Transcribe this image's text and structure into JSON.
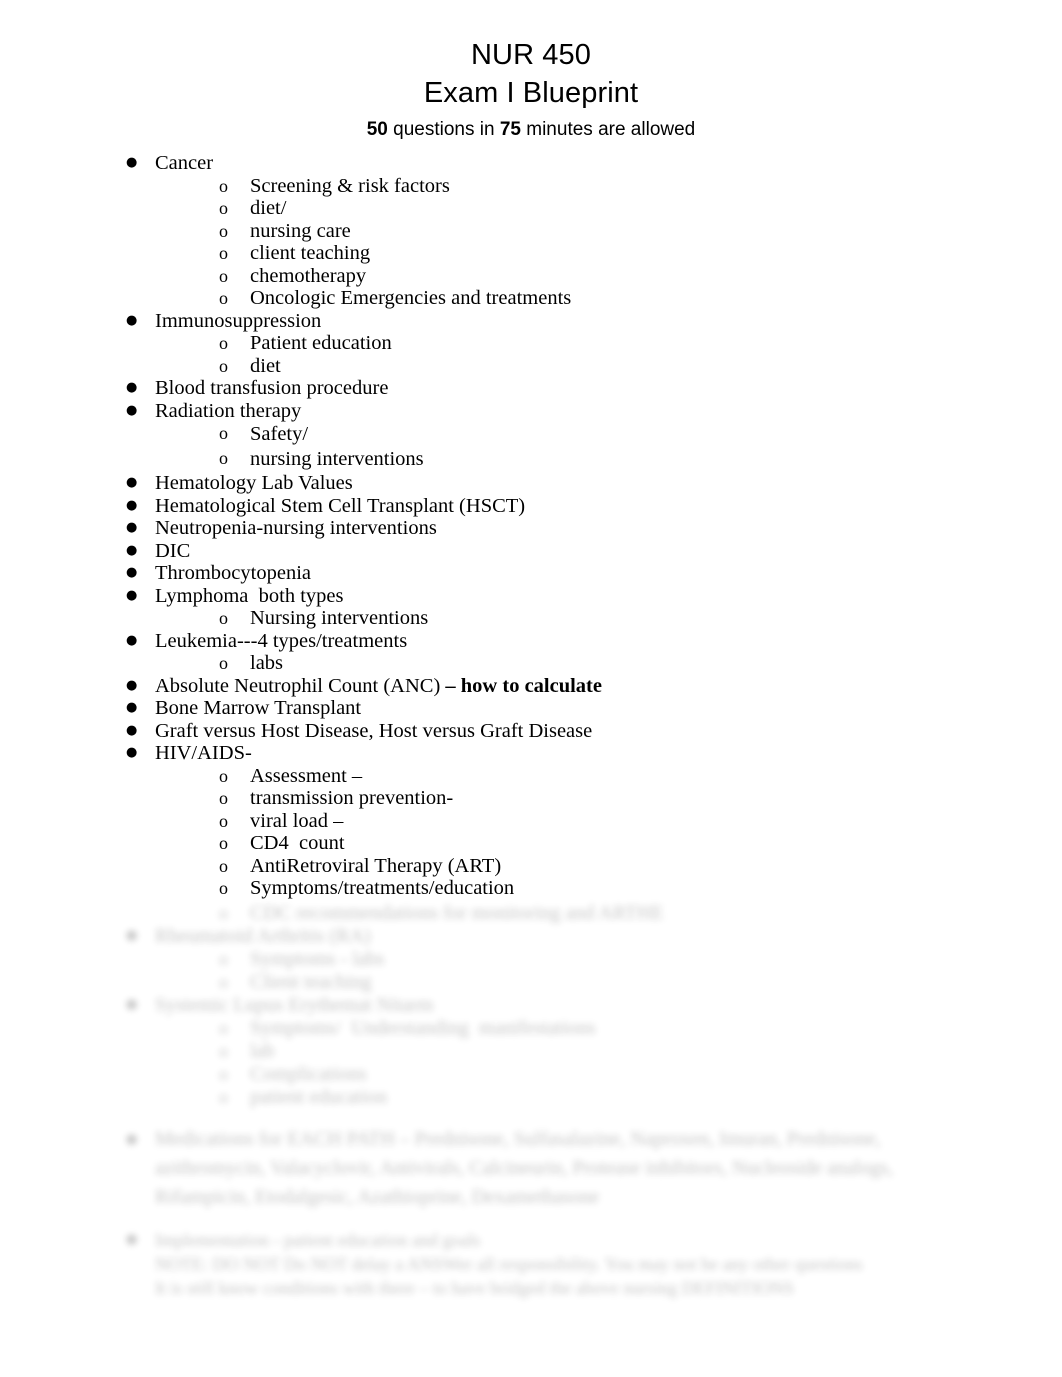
{
  "document": {
    "title_line_1": "NUR 450",
    "title_line_2": "Exam I Blueprint",
    "subtitle": {
      "question_count": "50",
      "mid_text": " questions in ",
      "minute_count": "75",
      "tail_text": " minutes are allowed"
    }
  },
  "outline": [
    {
      "label": "Cancer",
      "children": [
        {
          "label": "Screening & risk factors"
        },
        {
          "label": "diet/"
        },
        {
          "label": "nursing care"
        },
        {
          "label": "client teaching"
        },
        {
          "label": "chemotherapy"
        },
        {
          "label": "Oncologic Emergencies and treatments"
        }
      ]
    },
    {
      "label": "Immunosuppression",
      "children": [
        {
          "label": "Patient education"
        },
        {
          "label": "diet"
        }
      ]
    },
    {
      "label": "Blood transfusion procedure",
      "children": []
    },
    {
      "label": "Radiation therapy",
      "children": [
        {
          "label": "Safety/"
        },
        {
          "label": "nursing interventions"
        }
      ]
    },
    {
      "label": "Hematology Lab Values",
      "children": []
    },
    {
      "label": "Hematological Stem Cell Transplant (HSCT)",
      "children": []
    },
    {
      "label": "Neutropenia-nursing interventions",
      "children": []
    },
    {
      "label": "DIC",
      "children": []
    },
    {
      "label": "Thrombocytopenia",
      "children": []
    },
    {
      "label": "Lymphoma  both types",
      "children": [
        {
          "label": "Nursing interventions"
        }
      ]
    },
    {
      "label": "Leukemia---4 types/treatments",
      "children": [
        {
          "label": "labs"
        }
      ]
    },
    {
      "label_plain": "Absolute Neutrophil Count (ANC) ",
      "label_bold": "– how to calculate",
      "children": []
    },
    {
      "label": "Bone Marrow Transplant",
      "children": []
    },
    {
      "label": "Graft versus Host Disease, Host versus Graft Disease",
      "children": []
    },
    {
      "label": "HIV/AIDS-",
      "children": [
        {
          "label": "Assessment –"
        },
        {
          "label": "transmission prevention-"
        },
        {
          "label": "viral load –"
        },
        {
          "label": "CD4  count"
        },
        {
          "label": "AntiRetroviral Therapy (ART)"
        },
        {
          "label": "Symptoms/treatments/education"
        }
      ]
    }
  ],
  "redacted": {
    "note": "Remaining content is obscured by blur in the source image and is not legible.",
    "placeholder_lines": [
      {
        "level": 2,
        "text": "CDC recommendations for monitoring and ARTHE"
      },
      {
        "level": 1,
        "text": "Rheumatoid Arthritis (RA)"
      },
      {
        "level": 2,
        "text": "Symptoms - labs"
      },
      {
        "level": 2,
        "text": "Client teaching"
      },
      {
        "level": 1,
        "text": "Systemic Lupus Erythemat Nitarm"
      },
      {
        "level": 2,
        "text": "Symptoms/  Understanding  manifestations"
      },
      {
        "level": 2,
        "text": "lab"
      },
      {
        "level": 2,
        "text": "Complications"
      },
      {
        "level": 2,
        "text": "patient education"
      }
    ],
    "paragraph": {
      "text": "Medications for EACH PATH –   Prednisone, Sulfasalazine, Naproxen, Imuran, Prednisone, azithromycin, Valacyclovir, Antivirals, Calcineurin, Protease inhibitors, Nucleoside analogs, Rifampicin, Etodalgesic, Azathioprine, Dexamethasone"
    },
    "closing": {
      "line1": "Implementation - patient education and goals",
      "line2": "NOTE: DO NOT     Do NOT  delay  a  ANSWer  all responsibility.   You may  not be any other questions",
      "line3": "It is still know conditions with there – to have bridged the above nursing          DEFINITIONS"
    }
  }
}
